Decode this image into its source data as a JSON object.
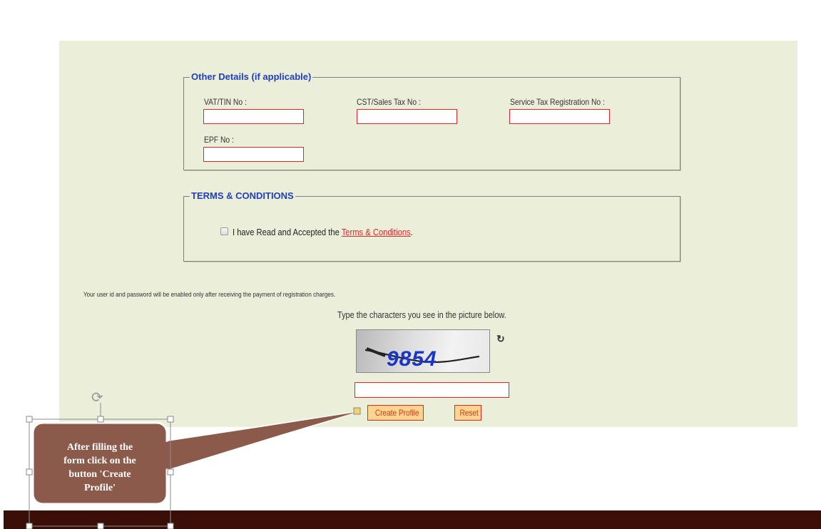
{
  "other_details": {
    "legend": "Other Details (if applicable)",
    "fields": [
      {
        "label": "VAT/TIN No :",
        "value": ""
      },
      {
        "label": "CST/Sales Tax No :",
        "value": ""
      },
      {
        "label": "Service Tax Registration No :",
        "value": ""
      },
      {
        "label": "EPF No :",
        "value": ""
      }
    ]
  },
  "terms": {
    "legend": "TERMS & CONDITIONS",
    "checkbox_text": "I have Read and Accepted the ",
    "link_text": "Terms & Conditions",
    "suffix": ".",
    "checked": false
  },
  "note": "Your user id and password will be enabled only after receiving the payment of registration charges.",
  "captcha": {
    "instruction": "Type the characters you see in the picture below.",
    "image_text": "9854",
    "refresh_icon": "refresh-icon",
    "value": ""
  },
  "buttons": {
    "create_profile": "Create Profile",
    "reset": "Reset"
  },
  "callout": {
    "lines": [
      "After filling the",
      "form click on the",
      "button 'Create",
      "Profile'"
    ],
    "fill": "#8b5a4a"
  },
  "colors": {
    "panel_bg": "#ebeed9",
    "legend": "#1f3fbf",
    "input_border": "#e8242a",
    "button_bg": "#fdd58f",
    "footer": "#3a0f08"
  }
}
